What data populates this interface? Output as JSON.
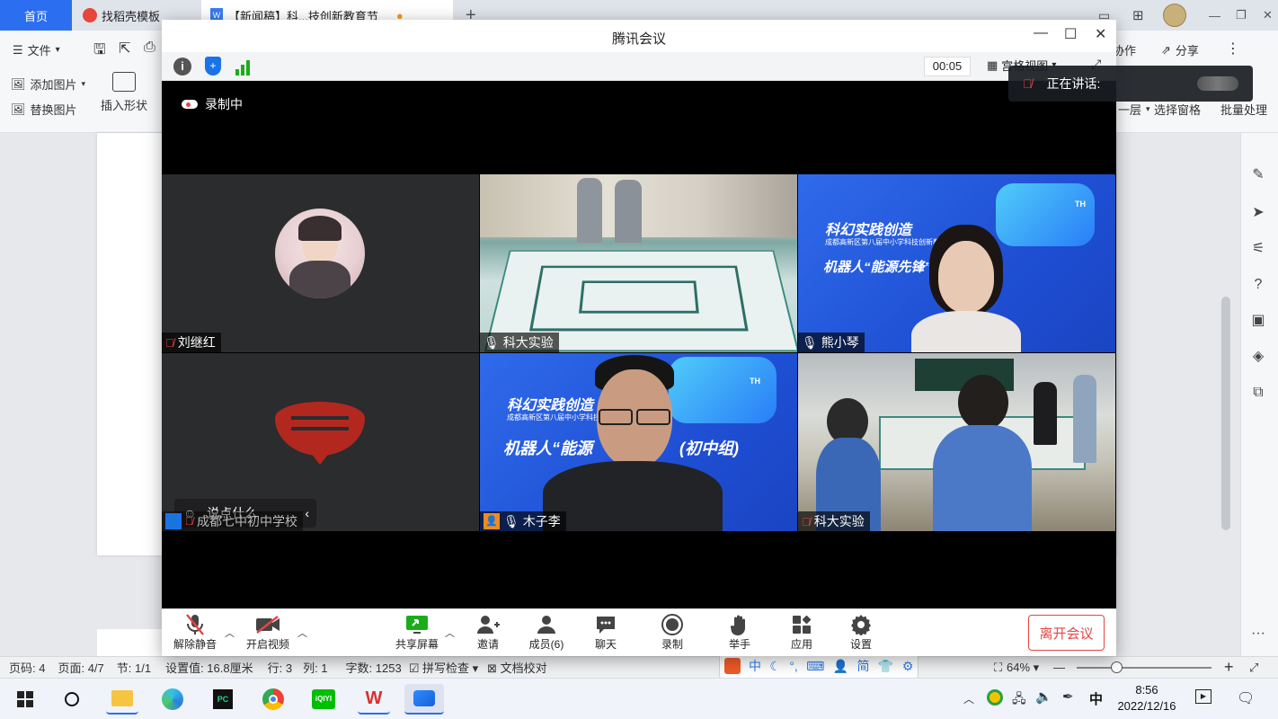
{
  "wps": {
    "tabs": [
      {
        "label": "首页"
      },
      {
        "label": "找稻壳模板"
      },
      {
        "label": "【新闻稿】科...技创新教育节"
      }
    ],
    "toolbar": {
      "file_label": "文件",
      "add_picture": "添加图片",
      "replace_picture": "替换图片",
      "insert_shape": "插入形状",
      "collaborate": "协作",
      "share": "分享",
      "prev_layer": "一层",
      "select_pane": "选择窗格",
      "batch_process": "批量处理"
    },
    "status": {
      "page_code": "页码: 4",
      "page": "页面: 4/7",
      "section": "节: 1/1",
      "setting": "设置值: 16.8厘米",
      "row": "行: 3",
      "col": "列: 1",
      "words": "字数: 1253",
      "spell_check": "拼写检查",
      "doc_proof": "文档校对",
      "zoom": "64%"
    },
    "ime": {
      "mode": "中",
      "simp": "简"
    }
  },
  "meeting": {
    "title": "腾讯会议",
    "timer": "00:05",
    "view_label": "宫格视图",
    "recording": "录制中",
    "speaking_label": "正在讲话:",
    "chat_placeholder": "说点什么",
    "participants": [
      {
        "name": "刘继红",
        "mic": "muted"
      },
      {
        "name": "科大实验",
        "mic": "on"
      },
      {
        "name": "熊小琴",
        "mic": "on"
      },
      {
        "name": "成都七中初中学校",
        "mic": "muted"
      },
      {
        "name": "木子李",
        "mic": "on"
      },
      {
        "name": "科大实验",
        "mic": "muted"
      }
    ],
    "poster_texts": {
      "headline": "科幻实践创造",
      "subline": "成都高新区第八届中小学科技创新教育节",
      "robot": "机器人“能源先锋”（初中组）",
      "robot_short": "机器人“能源",
      "group": "(初中组)",
      "th": "TH"
    },
    "controls": {
      "unmute": "解除静音",
      "start_video": "开启视频",
      "share_screen": "共享屏幕",
      "invite": "邀请",
      "members": "成员(6)",
      "chat": "聊天",
      "record": "录制",
      "raise_hand": "举手",
      "apps": "应用",
      "settings": "设置",
      "leave": "离开会议"
    }
  },
  "taskbar": {
    "ime": "中",
    "time": "8:56",
    "date": "2022/12/16"
  },
  "colors": {
    "wps_red": "#d9322b",
    "meeting_blue": "#1a73e8",
    "leave_red": "#e54545",
    "poster_blue": "#1f56d8"
  }
}
